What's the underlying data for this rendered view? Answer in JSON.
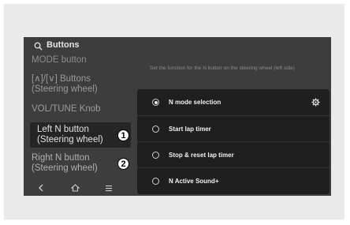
{
  "header": {
    "title": "Buttons"
  },
  "menu": {
    "items": [
      {
        "label": "MODE button"
      },
      {
        "label_line1": "[∧]/[∨] Buttons",
        "label_line2": "(Steering wheel)"
      },
      {
        "label": "VOL/TUNE Knob"
      },
      {
        "label_line1": "Left N button",
        "label_line2": "(Steering wheel)",
        "badge": "1"
      },
      {
        "label_line1": "Right N button",
        "label_line2": "(Steering wheel)",
        "badge": "2"
      }
    ]
  },
  "hint": "Set the function for the N button on the steering wheel (left side)",
  "popup": {
    "options": [
      {
        "label": "N mode selection",
        "checked": true
      },
      {
        "label": "Start lap timer",
        "checked": false
      },
      {
        "label": "Stop & reset lap timer",
        "checked": false
      },
      {
        "label": "N Active Sound+",
        "checked": false
      }
    ]
  },
  "bottom_bar": {
    "icons": [
      "back-icon",
      "home-icon",
      "menu-icon"
    ]
  },
  "colors": {
    "screen_bg": "#3d3d3d",
    "popup_bg": "#1f1f1f",
    "selected_bg": "#252525"
  }
}
